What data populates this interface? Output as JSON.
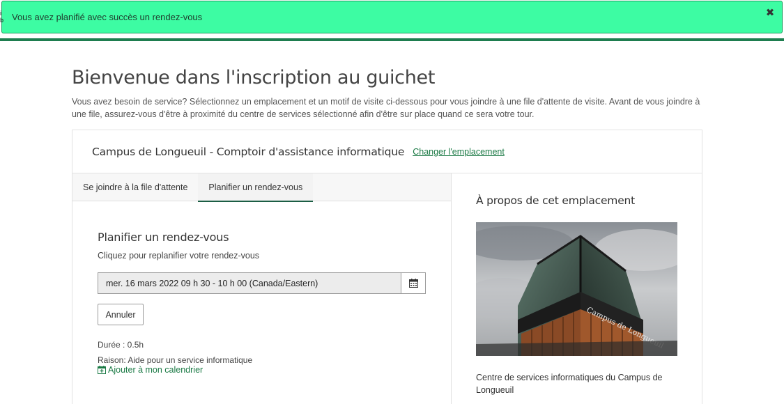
{
  "alert": {
    "message": "Vous avez planifié avec succès un rendez-vous",
    "close_icon": "close-icon"
  },
  "edge": {
    "marks": [
      "i",
      "b"
    ]
  },
  "page": {
    "title": "Bienvenue dans l'inscription au guichet",
    "intro": "Vous avez besoin de service? Sélectionnez un emplacement et un motif de visite ci-dessous pour vous joindre à une file d'attente de visite. Avant de vous joindre à une file, assurez-vous d'être à proximité du centre de services sélectionné afin d'être sur place quand ce sera votre tour."
  },
  "location": {
    "name": "Campus de Longueuil - Comptoir d'assistance informatique",
    "change_label": "Changer l'emplacement"
  },
  "tabs": [
    {
      "label": "Se joindre à la file d'attente",
      "active": false
    },
    {
      "label": "Planifier un rendez-vous",
      "active": true
    }
  ],
  "schedule": {
    "title": "Planifier un rendez-vous",
    "subtitle": "Cliquez pour replanifier votre rendez-vous",
    "date_value": "mer. 16 mars 2022 09 h 30 - 10 h 00 (Canada/Eastern)",
    "calendar_icon": "calendar-icon",
    "cancel_label": "Annuler",
    "duration": "Durée : 0.5h",
    "reason": "Raison: Aide pour un service informatique",
    "add_calendar_label": "Ajouter à mon calendrier"
  },
  "about": {
    "title": "À propos de cet emplacement",
    "photo_sign": "Campus de Longueuil",
    "caption": "Centre de services informatiques du Campus de Longueuil"
  },
  "colors": {
    "alert_bg": "#3dfca3",
    "accent_green": "#1b7a45",
    "header_rule": "#1e7d4f",
    "tab_underline": "#1b5e44"
  }
}
